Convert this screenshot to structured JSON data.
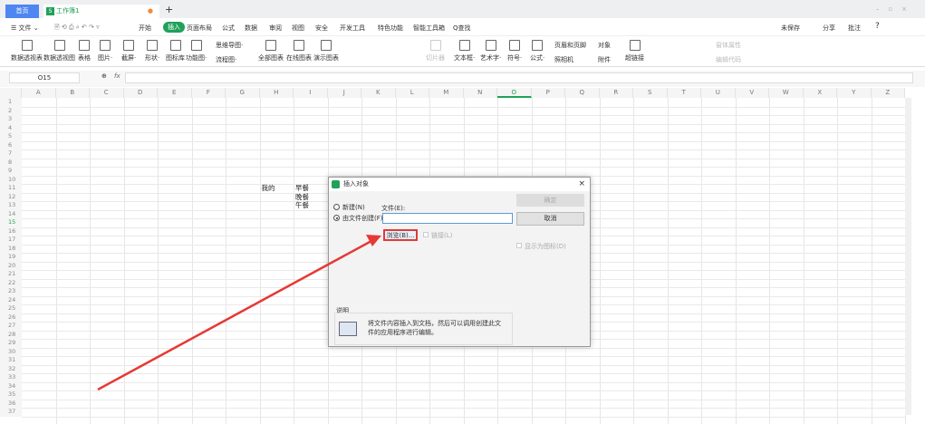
{
  "tabs": {
    "home": "首页",
    "workbook": "工作簿1",
    "add": "+"
  },
  "menu": {
    "file": "☰ 文件 ⌄",
    "items": [
      "开始",
      "插入",
      "页面布局",
      "公式",
      "数据",
      "审阅",
      "视图",
      "安全",
      "开发工具",
      "特色功能",
      "智能工具箱"
    ],
    "active": "插入",
    "search": "Q查找",
    "unsaved": "未保存",
    "share": "分享",
    "comment": "批注",
    "help": "?"
  },
  "ribbon": [
    {
      "label": "数据透视表"
    },
    {
      "label": "数据透视图"
    },
    {
      "label": "表格"
    },
    {
      "label": "图片·"
    },
    {
      "label": "截屏·"
    },
    {
      "label": "形状·"
    },
    {
      "label": "图标库"
    },
    {
      "label": "功能图·"
    },
    {
      "label": "思维导图·"
    },
    {
      "label": "流程图·"
    },
    {
      "label": "全部图表"
    },
    {
      "label": "在线图表"
    },
    {
      "label": "演示图表"
    },
    {
      "label": "切片器",
      "disabled": true
    },
    {
      "label": "文本框·"
    },
    {
      "label": "艺术字·"
    },
    {
      "label": "符号·"
    },
    {
      "label": "公式·"
    },
    {
      "label": "页眉和页脚"
    },
    {
      "label": "照相机"
    },
    {
      "label": "对象"
    },
    {
      "label": "附件"
    },
    {
      "label": "超链接"
    },
    {
      "label": "窗体属性",
      "disabled": true
    },
    {
      "label": "编辑代码",
      "disabled": true
    }
  ],
  "formula_bar": {
    "name_box": "O15",
    "fx": "fx",
    "value": ""
  },
  "columns": [
    "A",
    "B",
    "C",
    "D",
    "E",
    "F",
    "G",
    "H",
    "I",
    "J",
    "K",
    "L",
    "M",
    "N",
    "O",
    "P",
    "Q",
    "R",
    "S",
    "T",
    "U",
    "V",
    "W",
    "X",
    "Y",
    "Z"
  ],
  "row_count": 37,
  "cells": {
    "H11": "我的",
    "I11": "早餐",
    "I12": "晚餐",
    "I13": "午餐"
  },
  "dialog": {
    "title": "插入对象",
    "close": "×",
    "opt_new": "新建(N)",
    "opt_from_file": "由文件创建(F)",
    "file_label": "文件(E):",
    "file_value": "",
    "browse": "浏览(B)...",
    "link": "链接(L)",
    "ok": "确定",
    "cancel": "取消",
    "show_icon": "显示为图标(D)",
    "desc_title": "说明",
    "desc_text": "将文件内容插入到文档，然后可以调用创建此文件的应用程序进行编辑。"
  },
  "colors": {
    "accent": "#1fa15a",
    "highlight": "#e53935"
  }
}
